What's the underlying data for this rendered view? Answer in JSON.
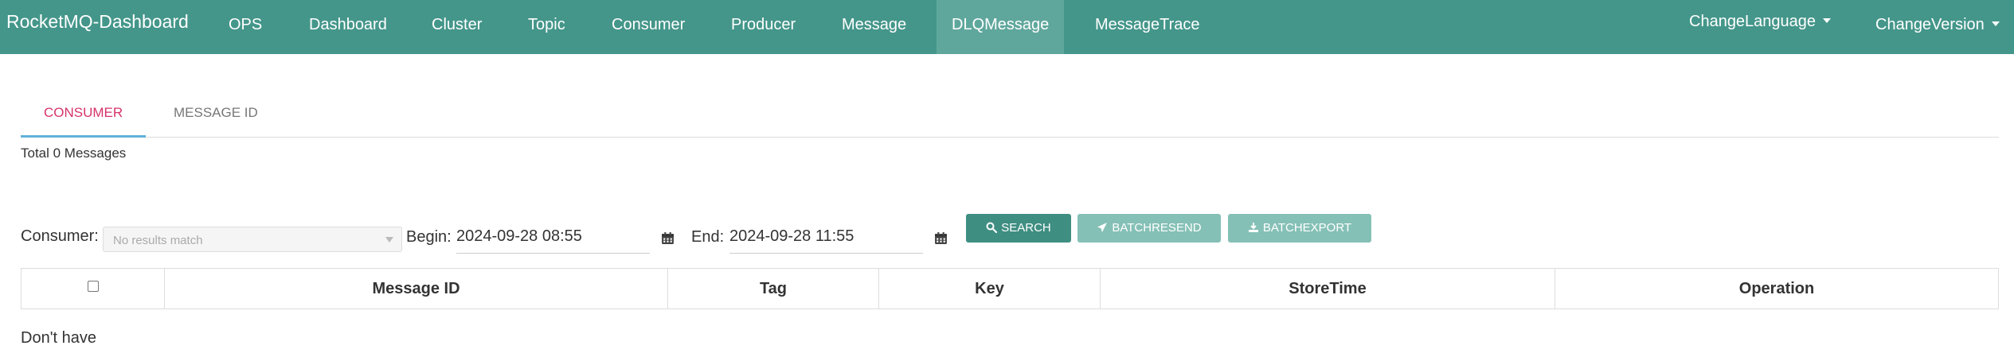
{
  "navbar": {
    "brand": "RocketMQ-Dashboard",
    "items": [
      {
        "label": "OPS"
      },
      {
        "label": "Dashboard"
      },
      {
        "label": "Cluster"
      },
      {
        "label": "Topic"
      },
      {
        "label": "Consumer"
      },
      {
        "label": "Producer"
      },
      {
        "label": "Message"
      },
      {
        "label": "DLQMessage",
        "active": true
      },
      {
        "label": "MessageTrace"
      }
    ],
    "change_language": "ChangeLanguage",
    "change_version": "ChangeVersion"
  },
  "tabs": [
    {
      "label": "CONSUMER",
      "active": true
    },
    {
      "label": "MESSAGE ID",
      "active": false
    }
  ],
  "summary": "Total 0 Messages",
  "filters": {
    "consumer_label": "Consumer:",
    "consumer_placeholder": "No results match",
    "begin_label": "Begin:",
    "begin_value": "2024-09-28 08:55",
    "end_label": "End:",
    "end_value": "2024-09-28 11:55"
  },
  "buttons": {
    "search": "SEARCH",
    "batch_resend": "BATCHRESEND",
    "batch_export": "BATCHEXPORT"
  },
  "table": {
    "columns": [
      "Message ID",
      "Tag",
      "Key",
      "StoreTime",
      "Operation"
    ],
    "empty_text": "Don't have"
  },
  "colors": {
    "navbar": "#44968a",
    "navbar_active": "#5fa79c",
    "tab_active_text": "#d6336c",
    "tab_active_underline": "#5fb0d9",
    "button_primary": "#3f8e82",
    "button_disabled": "#85c0b6"
  },
  "icons": {
    "search": "search-icon",
    "resend": "paper-plane-icon",
    "export": "export-icon",
    "calendar": "calendar-icon",
    "caret": "caret-down-icon"
  }
}
